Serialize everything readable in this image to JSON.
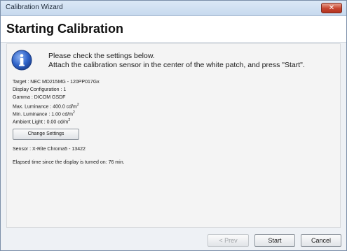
{
  "window": {
    "title": "Calibration Wizard",
    "close_label": "✕"
  },
  "header": {
    "title": "Starting Calibration"
  },
  "message": {
    "line1": "Please check the settings below.",
    "line2": "Attach the calibration sensor in the center of the white patch, and press \"Start\"."
  },
  "settings": {
    "target": "Target : NEC MD215MG - 120PP017Gx",
    "display_configuration": "Display Configuration : 1",
    "gamma": "Gamma : DICOM GSDF",
    "max_luminance": "Max. Luminance : 400.0 cd/m",
    "min_luminance": "Min. Luminance : 1.00 cd/m",
    "ambient_light": "Ambient Light : 0.00 cd/m",
    "unit_superscript": "2"
  },
  "change_settings_label": "Change Settings",
  "sensor": "Sensor : X-Rite Chroma5 - 13422",
  "elapsed": "Elapsed time since the display is turned on: 76 min.",
  "buttons": {
    "prev": "< Prev",
    "start": "Start",
    "cancel": "Cancel"
  },
  "colors": {
    "info_icon": "#2f63c9",
    "close_button": "#c6452f"
  },
  "icons": {
    "info": "info-icon",
    "close": "close-icon"
  }
}
